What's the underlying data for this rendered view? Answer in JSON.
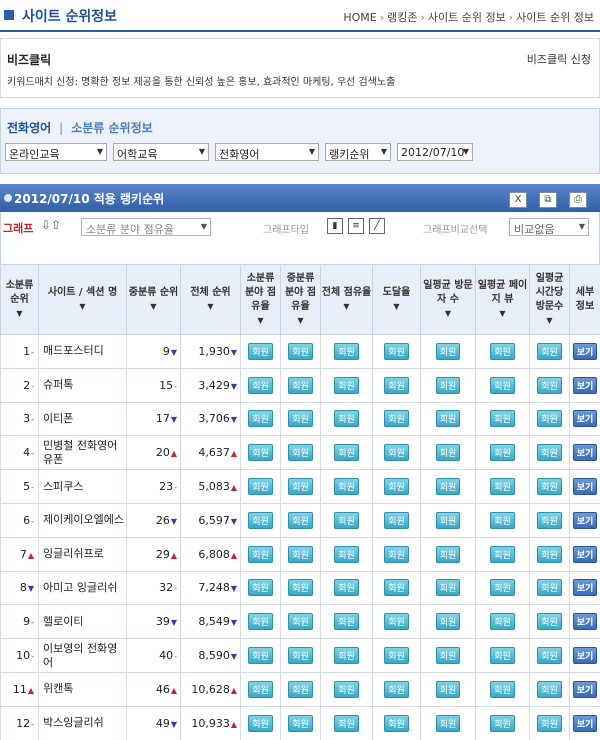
{
  "header": {
    "title": "사이트 순위정보",
    "breadcrumb": [
      "HOME",
      "랭킹존",
      "사이트 순위 정보",
      "사이트 순위 정보"
    ]
  },
  "ad": {
    "title": "비즈클릭",
    "apply": "비즈클릭 신청",
    "desc": "키워드매치 신청: 명확한 정보 제공을 통한 신뢰성 높은 홍보, 효과적인 마케팅, 우선 검색노출"
  },
  "filter": {
    "tab_main": "전화영어",
    "tab_sep": "|",
    "tab_sub": "소분류 순위정보",
    "selects": [
      "온라인교육",
      "어학교육",
      "전화영어",
      "랭키순위",
      "2012/07/10"
    ]
  },
  "ranking": {
    "title": "2012/07/10 적용 랭키순위",
    "graph_label": "그래프",
    "graph_select": "소분류 분야 점유율",
    "graph_type_label": "그래프타입",
    "compare_label": "그래프비교선택",
    "compare_select": "비교없음"
  },
  "table": {
    "headers": {
      "rank": "소분류 순위",
      "site": "사이트 / 섹션 명",
      "mid_rank": "중분류 순위",
      "total_rank": "전체 순위",
      "sub_share": "소분류 분야 점유율",
      "mid_share": "중분류 분야 점유율",
      "total_share": "전체 점유율",
      "reach": "도달율",
      "daily_visitors": "일평균 방문자 수",
      "daily_pageviews": "일평균 페이지 뷰",
      "hourly_visits": "일평균 시간당 방문수",
      "detail": "세부 정보"
    },
    "member_label": "회원",
    "view_label": "보기",
    "rows": [
      {
        "rank": "1",
        "rank_trend": "same",
        "site": "매드포스터디",
        "mid": "9",
        "mid_trend": "down",
        "total": "1,930",
        "total_trend": "down"
      },
      {
        "rank": "2",
        "rank_trend": "same",
        "site": "슈퍼톡",
        "mid": "15",
        "mid_trend": "same",
        "total": "3,429",
        "total_trend": "down"
      },
      {
        "rank": "3",
        "rank_trend": "same",
        "site": "이티폰",
        "mid": "17",
        "mid_trend": "down",
        "total": "3,706",
        "total_trend": "down"
      },
      {
        "rank": "4",
        "rank_trend": "same",
        "site": "민병철 전화영어 유폰",
        "mid": "20",
        "mid_trend": "up",
        "total": "4,637",
        "total_trend": "up"
      },
      {
        "rank": "5",
        "rank_trend": "same",
        "site": "스피쿠스",
        "mid": "23",
        "mid_trend": "same",
        "total": "5,083",
        "total_trend": "up"
      },
      {
        "rank": "6",
        "rank_trend": "same",
        "site": "제이케이오엘에스",
        "mid": "26",
        "mid_trend": "down",
        "total": "6,597",
        "total_trend": "down"
      },
      {
        "rank": "7",
        "rank_trend": "up",
        "site": "잉글리쉬프로",
        "mid": "29",
        "mid_trend": "up",
        "total": "6,808",
        "total_trend": "up"
      },
      {
        "rank": "8",
        "rank_trend": "down",
        "site": "아미고 잉글리쉬",
        "mid": "32",
        "mid_trend": "same",
        "total": "7,248",
        "total_trend": "down"
      },
      {
        "rank": "9",
        "rank_trend": "same",
        "site": "헬로이티",
        "mid": "39",
        "mid_trend": "down",
        "total": "8,549",
        "total_trend": "down"
      },
      {
        "rank": "10",
        "rank_trend": "same",
        "site": "이보영의 전화영어",
        "mid": "40",
        "mid_trend": "same",
        "total": "8,590",
        "total_trend": "down"
      },
      {
        "rank": "11",
        "rank_trend": "up",
        "site": "위캔톡",
        "mid": "46",
        "mid_trend": "up",
        "total": "10,628",
        "total_trend": "up"
      },
      {
        "rank": "12",
        "rank_trend": "same",
        "site": "박스잉글리쉬",
        "mid": "49",
        "mid_trend": "down",
        "total": "10,933",
        "total_trend": "up"
      }
    ]
  }
}
